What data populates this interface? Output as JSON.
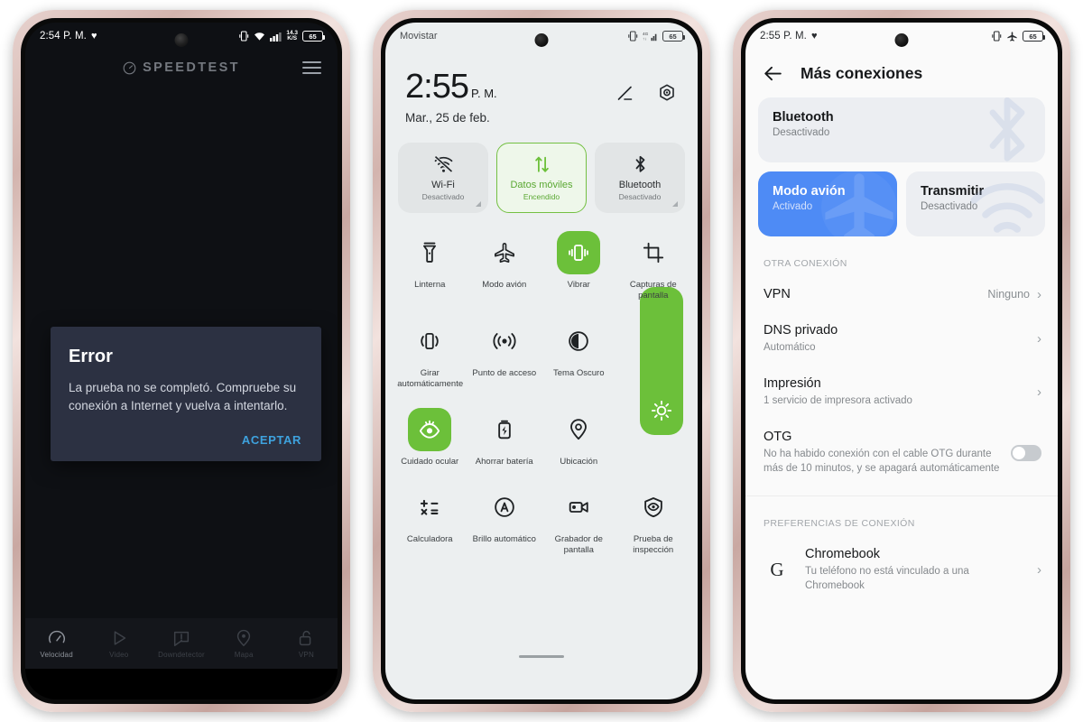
{
  "phone1": {
    "statusbar": {
      "time": "2:54 P. M.",
      "heart_icon": "heart-icon",
      "vibrate_icon": "vibrate-icon",
      "wifi_icon": "wifi-icon",
      "signal_icon": "signal-bars-icon",
      "netspeed_value": "14.3",
      "netspeed_unit": "K/S",
      "battery": "65"
    },
    "app": {
      "logo_label": "SPEEDTEST",
      "logo_icon": "speedtest-gauge-icon",
      "menu_icon": "hamburger-menu-icon"
    },
    "dialog": {
      "title": "Error",
      "message": "La prueba no se completó. Compruebe su conexión a Internet y vuelva a intentarlo.",
      "accept_label": "ACEPTAR",
      "accent_color": "#3ea2de",
      "background_color": "#2c3142"
    },
    "tabs": [
      {
        "label": "Velocidad",
        "icon": "gauge-icon",
        "active": true
      },
      {
        "label": "Video",
        "icon": "play-triangle-icon",
        "active": false
      },
      {
        "label": "Downdetector",
        "icon": "alert-speech-icon",
        "active": false
      },
      {
        "label": "Mapa",
        "icon": "map-pin-icon",
        "active": false
      },
      {
        "label": "VPN",
        "icon": "padlock-open-icon",
        "active": false
      }
    ]
  },
  "phone2": {
    "statusbar": {
      "carrier": "Movistar",
      "vibrate_icon": "vibrate-icon",
      "signal_icon": "signal-4g-icon",
      "battery": "65"
    },
    "clock": {
      "time": "2:55",
      "meridiem": "P. M.",
      "date": "Mar., 25 de feb."
    },
    "header_actions": [
      {
        "name": "edit-pencil-icon",
        "label": "edit"
      },
      {
        "name": "settings-gear-icon",
        "label": "settings"
      }
    ],
    "tiles": [
      {
        "name": "Wi-Fi",
        "state": "Desactivado",
        "icon": "wifi-off-icon",
        "on": false,
        "expandable": true
      },
      {
        "name": "Datos móviles",
        "state": "Encendido",
        "icon": "mobile-data-icon",
        "on": true,
        "expandable": false
      },
      {
        "name": "Bluetooth",
        "state": "Desactivado",
        "icon": "bluetooth-icon",
        "on": false,
        "expandable": true
      }
    ],
    "toggles": [
      {
        "label": "Linterna",
        "icon": "flashlight-icon",
        "on": false
      },
      {
        "label": "Modo avión",
        "icon": "airplane-icon",
        "on": false
      },
      {
        "label": "Vibrar",
        "icon": "vibrate-phone-icon",
        "on": true
      },
      {
        "label": "Capturas de pantalla",
        "icon": "screenshot-crop-icon",
        "on": false
      },
      {
        "label": "Girar automáticamente",
        "icon": "auto-rotate-icon",
        "on": false
      },
      {
        "label": "Punto de acceso",
        "icon": "hotspot-icon",
        "on": false
      },
      {
        "label": "Tema Oscuro",
        "icon": "dark-theme-icon",
        "on": false
      },
      {
        "label": "",
        "icon": "brightness-slider",
        "on": true
      },
      {
        "label": "Cuidado ocular",
        "icon": "eye-care-icon",
        "on": true
      },
      {
        "label": "Ahorrar batería",
        "icon": "battery-saver-icon",
        "on": false
      },
      {
        "label": "Ubicación",
        "icon": "location-pin-icon",
        "on": false
      },
      {
        "label": "Calculadora",
        "icon": "calculator-icon",
        "on": false
      },
      {
        "label": "Brillo automático",
        "icon": "auto-brightness-icon",
        "on": false
      },
      {
        "label": "Grabador de pantalla",
        "icon": "screen-recorder-icon",
        "on": false
      },
      {
        "label": "Prueba de inspección",
        "icon": "shield-eye-icon",
        "on": false
      }
    ],
    "brightness": {
      "icon": "sun-brightness-icon",
      "level_percent": 100,
      "color": "#6cc03a"
    }
  },
  "phone3": {
    "statusbar": {
      "time": "2:55 P. M.",
      "heart_icon": "heart-icon",
      "vibrate_icon": "vibrate-icon",
      "airplane_icon": "airplane-icon",
      "battery": "65"
    },
    "header": {
      "back_icon": "back-arrow-icon",
      "title": "Más conexiones"
    },
    "cards": [
      {
        "title": "Bluetooth",
        "sub": "Desactivado",
        "icon": "bluetooth-icon",
        "on": false
      },
      {
        "title": "Modo avión",
        "sub": "Activado",
        "icon": "airplane-icon",
        "on": true
      },
      {
        "title": "Transmitir",
        "sub": "Desactivado",
        "icon": "cast-icon",
        "on": false
      }
    ],
    "sections": [
      {
        "title": "OTRA CONEXIÓN",
        "items": [
          {
            "title": "VPN",
            "sub": "",
            "value": "Ninguno",
            "control": "chevron",
            "icon": ""
          },
          {
            "title": "DNS privado",
            "sub": "Automático",
            "value": "",
            "control": "chevron",
            "icon": ""
          },
          {
            "title": "Impresión",
            "sub": "1 servicio de impresora activado",
            "value": "",
            "control": "chevron",
            "icon": ""
          },
          {
            "title": "OTG",
            "sub": "No ha habido conexión con el cable OTG durante más de 10 minutos, y se apagará automáticamente",
            "value": "",
            "control": "toggle-off",
            "icon": ""
          }
        ]
      },
      {
        "title": "PREFERENCIAS DE CONEXIÓN",
        "items": [
          {
            "title": "Chromebook",
            "sub": "Tu teléfono no está vinculado a una Chromebook",
            "value": "",
            "control": "chevron",
            "icon": "google-g-icon"
          }
        ]
      }
    ]
  },
  "colors": {
    "android_green": "#6cc03a",
    "accent_blue": "#4e8bf5",
    "speedtest_link": "#3ea2de"
  }
}
